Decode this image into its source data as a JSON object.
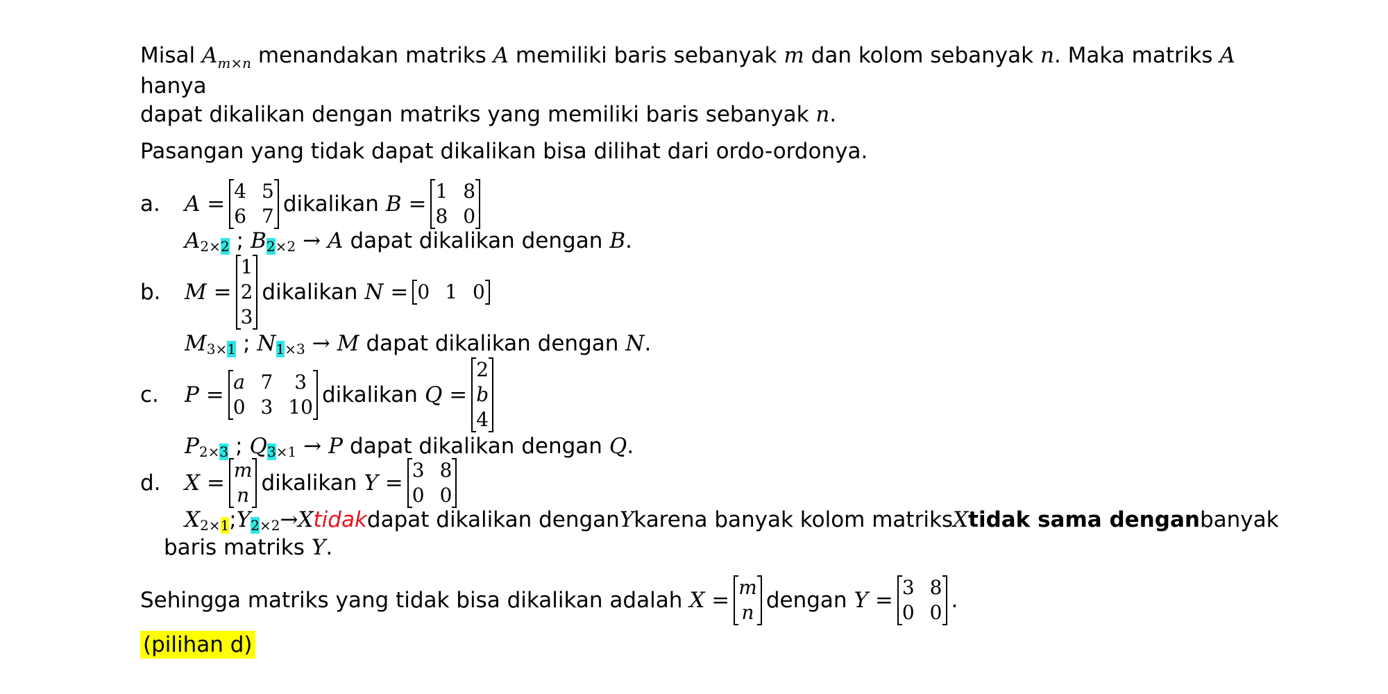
{
  "intro": {
    "misal": "Misal",
    "A": "A",
    "sub_mxn": "m×n",
    "t1": "menandakan matriks",
    "A2": "A",
    "t2": "memiliki baris sebanyak",
    "m": "m",
    "t3": "dan kolom sebanyak",
    "n": "n",
    "t4": ". Maka matriks",
    "A3": "A",
    "t5": "hanya",
    "line2": "dapat dikalikan dengan matriks yang memiliki baris sebanyak",
    "n2": "n",
    "dot": "."
  },
  "pairs_intro": "Pasangan yang tidak dapat dikalikan bisa dilihat dari ordo-ordonya.",
  "items": {
    "a": {
      "label": "a.",
      "lhs": "A =",
      "matrix1": [
        "4",
        "5",
        "6",
        "7"
      ],
      "mid": "dikalikan",
      "rhs": "B =",
      "matrix2": [
        "1",
        "8",
        "8",
        "0"
      ],
      "o1": "A",
      "o1_pre": "2×",
      "o1_hl": "2",
      "sep": ";",
      "o2": "B",
      "o2_hl": "2",
      "o2_post": "×2",
      "arrow": "→",
      "res_sym": "A",
      "res_text": "dapat dikalikan dengan",
      "res_sym2": "B",
      "end": "."
    },
    "b": {
      "label": "b.",
      "lhs": "M =",
      "matrix1": [
        "1",
        "2",
        "3"
      ],
      "mid": "dikalikan",
      "rhs": "N =",
      "matrix2": [
        "0",
        "1",
        "0"
      ],
      "o1": "M",
      "o1_pre": "3×",
      "o1_hl": "1",
      "sep": ";",
      "o2": "N",
      "o2_hl": "1",
      "o2_post": "×3",
      "arrow": "→",
      "res_sym": "M",
      "res_text": "dapat dikalikan dengan",
      "res_sym2": "N",
      "end": "."
    },
    "c": {
      "label": "c.",
      "lhs": "P =",
      "matrix1": [
        "a",
        "7",
        "3",
        "0",
        "3",
        "10"
      ],
      "mid": "dikalikan",
      "rhs": "Q =",
      "matrix2": [
        "2",
        "b",
        "4"
      ],
      "o1": "P",
      "o1_pre": "2×",
      "o1_hl": "3",
      "sep": ";",
      "o2": "Q",
      "o2_hl": "3",
      "o2_post": "×1",
      "arrow": "→",
      "res_sym": "P",
      "res_text": "dapat dikalikan dengan",
      "res_sym2": "Q",
      "end": "."
    },
    "d": {
      "label": "d.",
      "lhs": "X =",
      "matrix1": [
        "m",
        "n"
      ],
      "mid": "dikalikan",
      "rhs": "Y =",
      "matrix2": [
        "3",
        "8",
        "0",
        "0"
      ],
      "o1": "X",
      "o1_pre": "2×",
      "o1_hl": "1",
      "sep": ";",
      "o2": "Y",
      "o2_hl": "2",
      "o2_post": "×2",
      "arrow": "→",
      "res_sym": "X",
      "res_red": "tidak",
      "res_text": "dapat dikalikan dengan",
      "res_sym2": "Y",
      "res_text2": "karena banyak kolom matriks",
      "res_sym3": "X",
      "res_bold": "tidak sama dengan",
      "res_text3": "banyak",
      "line2": "baris matriks",
      "res_sym4": "Y",
      "end": "."
    }
  },
  "conclusion": {
    "text": "Sehingga matriks yang tidak bisa dikalikan adalah",
    "lhs": "X =",
    "matrix1": [
      "m",
      "n"
    ],
    "mid": "dengan",
    "rhs": "Y =",
    "matrix2": [
      "3",
      "8",
      "0",
      "0"
    ],
    "end": "."
  },
  "answer": "(pilihan d)",
  "colors": {
    "highlight_cyan": "#2ee6e6",
    "highlight_yellow": "#ffff00",
    "red": "#e8141e"
  }
}
